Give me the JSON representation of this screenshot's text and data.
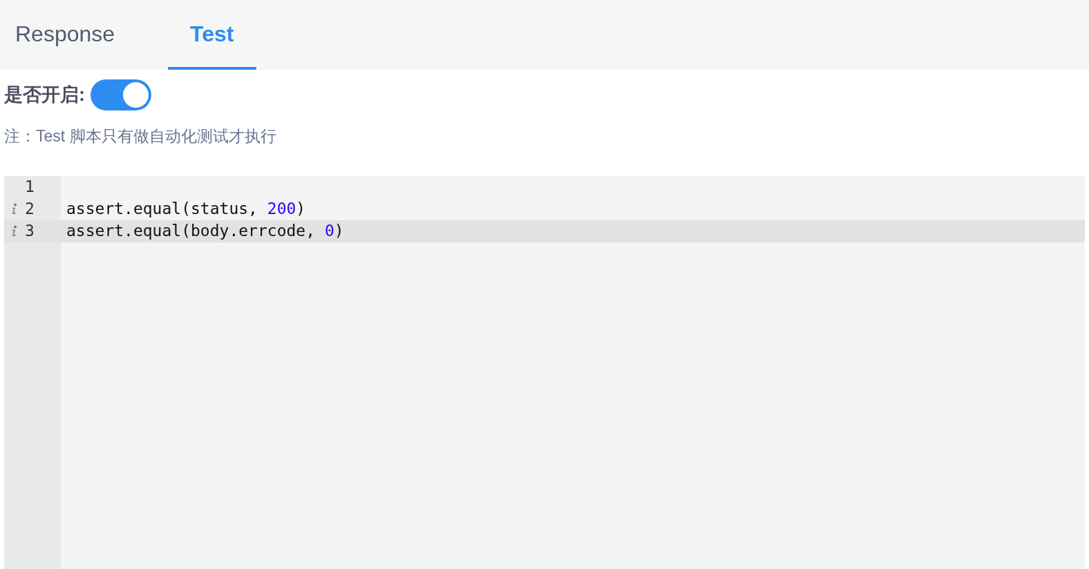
{
  "tabs": [
    {
      "label": "Response",
      "selected": false
    },
    {
      "label": "Test",
      "selected": true
    }
  ],
  "toggle": {
    "label": "是否开启:",
    "on": true
  },
  "note": "注：Test 脚本只有做自动化测试才执行",
  "editor": {
    "lines": [
      {
        "number": "1",
        "info": false,
        "active": false
      },
      {
        "number": "2",
        "info": true,
        "active": false,
        "tokens": [
          {
            "kind": "plain",
            "text": "assert.equal(status, "
          },
          {
            "kind": "number",
            "text": "200"
          },
          {
            "kind": "plain",
            "text": ")"
          }
        ]
      },
      {
        "number": "3",
        "info": true,
        "active": true,
        "tokens": [
          {
            "kind": "plain",
            "text": "assert.equal(body.errcode, "
          },
          {
            "kind": "number",
            "text": "0"
          },
          {
            "kind": "plain",
            "text": ")"
          }
        ]
      }
    ]
  }
}
